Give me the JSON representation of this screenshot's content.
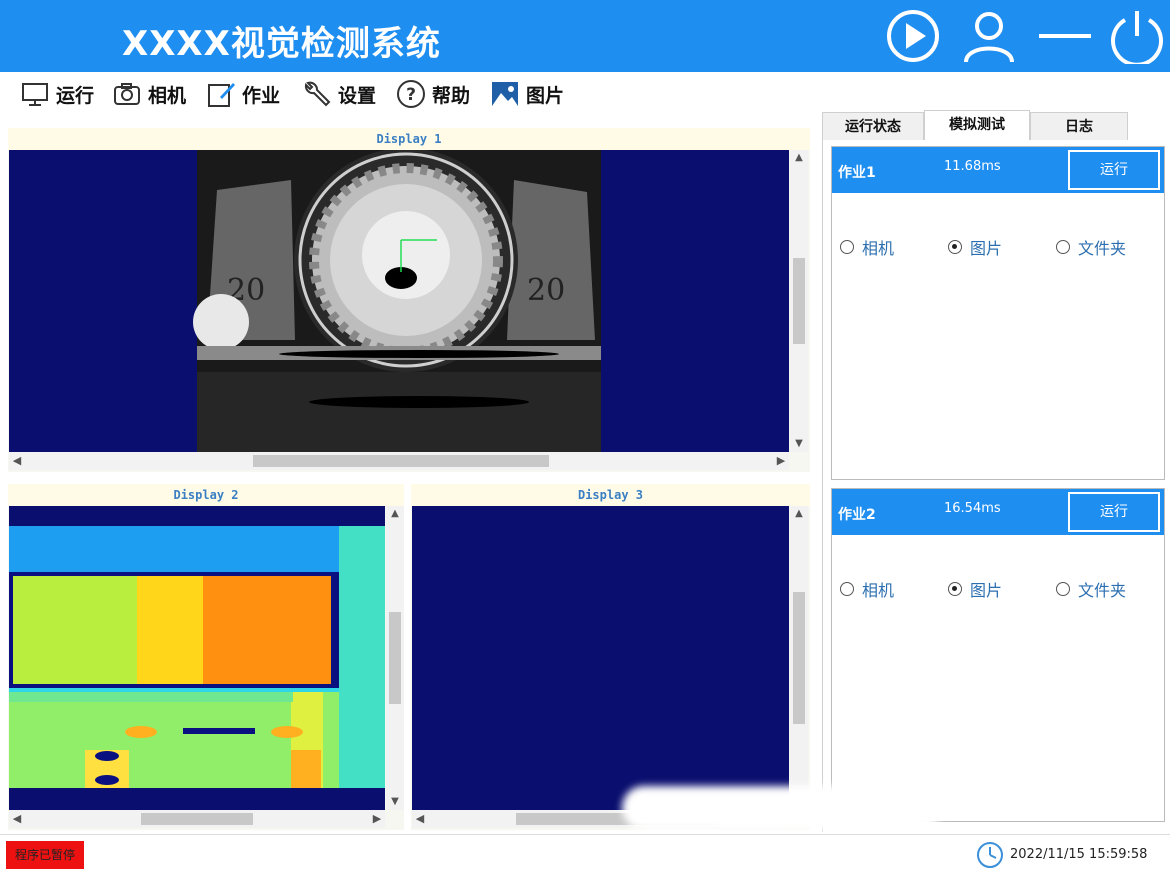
{
  "app": {
    "title": "XXXX视觉检测系统"
  },
  "header_icons": [
    "play-icon",
    "user-icon",
    "minimize-icon",
    "power-icon"
  ],
  "menu": {
    "items": [
      {
        "label": "运行",
        "icon": "monitor-icon"
      },
      {
        "label": "相机",
        "icon": "camera-icon"
      },
      {
        "label": "作业",
        "icon": "edit-icon"
      },
      {
        "label": "设置",
        "icon": "wrench-icon"
      },
      {
        "label": "帮助",
        "icon": "help-icon"
      },
      {
        "label": "图片",
        "icon": "image-icon"
      }
    ]
  },
  "displays": [
    {
      "title": "Display 1"
    },
    {
      "title": "Display 2"
    },
    {
      "title": "Display 3"
    }
  ],
  "right_panel": {
    "tabs": [
      {
        "label": "运行状态",
        "active": false
      },
      {
        "label": "模拟测试",
        "active": true
      },
      {
        "label": "日志",
        "active": false
      }
    ],
    "jobs": [
      {
        "name": "作业1",
        "time": "11.68ms",
        "run_label": "运行",
        "sources": [
          {
            "label": "相机",
            "selected": false
          },
          {
            "label": "图片",
            "selected": true
          },
          {
            "label": "文件夹",
            "selected": false
          }
        ]
      },
      {
        "name": "作业2",
        "time": "16.54ms",
        "run_label": "运行",
        "sources": [
          {
            "label": "相机",
            "selected": false
          },
          {
            "label": "图片",
            "selected": true
          },
          {
            "label": "文件夹",
            "selected": false
          }
        ]
      }
    ]
  },
  "status": {
    "state": "程序已暂停",
    "datetime": "2022/11/15 15:59:58",
    "state_color": "#ee1111"
  },
  "colors": {
    "accent": "#1f8ef1",
    "display_bg": "#0a0e6e",
    "radio_label": "#2c6fb0"
  }
}
